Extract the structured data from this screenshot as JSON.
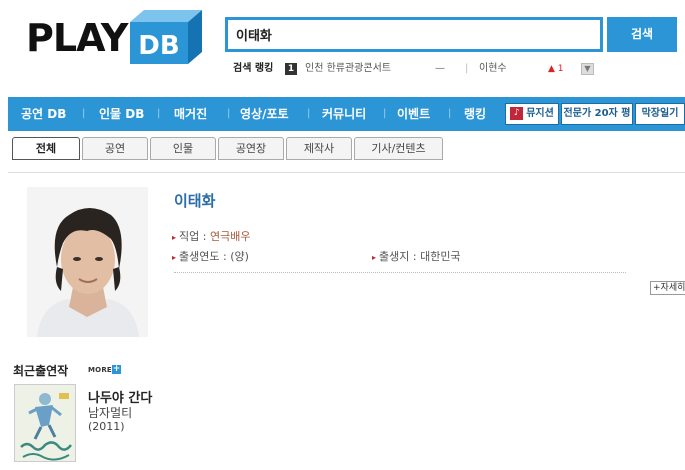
{
  "header": {
    "logo_text": "PLAY",
    "logo_badge": "DB",
    "search": {
      "value": "이태화",
      "button_label": "검색"
    },
    "ranking": {
      "label": "검색 랭킹",
      "rank": "1",
      "item": "인천 한류관광콘서트",
      "change_mark": "—",
      "separator": "|",
      "item2": "이현수",
      "change2": "▲ 1",
      "dropdown": "▼"
    }
  },
  "nav": {
    "items": [
      "공연 DB",
      "인물 DB",
      "매거진",
      "영상/포토",
      "커뮤니티",
      "이벤트",
      "랭킹"
    ],
    "separator": "|",
    "boxes": [
      {
        "label": "뮤지션",
        "icon": "music-note-icon",
        "icon_glyph": "♪"
      },
      {
        "label": "전문가 20자 평"
      },
      {
        "label": "막장일기"
      }
    ]
  },
  "tabs": [
    "전체",
    "공연",
    "인물",
    "공연장",
    "제작사",
    "기사/컨텐츠"
  ],
  "active_tab": "전체",
  "profile": {
    "name": "이태화",
    "job_label": "직업 : ",
    "job_value": "연극배우",
    "birth": "출생연도 : (양)",
    "birthplace": "출생지 : 대한민국",
    "more_label": "+자세히"
  },
  "recent": {
    "title": "최근출연작",
    "more": "MORE",
    "plus": "+",
    "works": [
      {
        "title": "나두야 간다",
        "subtitle": "남자멀티",
        "year": "(2011)"
      }
    ]
  },
  "colors": {
    "brand_blue": "#2b95d6",
    "accent_red": "#c0283a",
    "link_blue": "#2b6da8"
  }
}
